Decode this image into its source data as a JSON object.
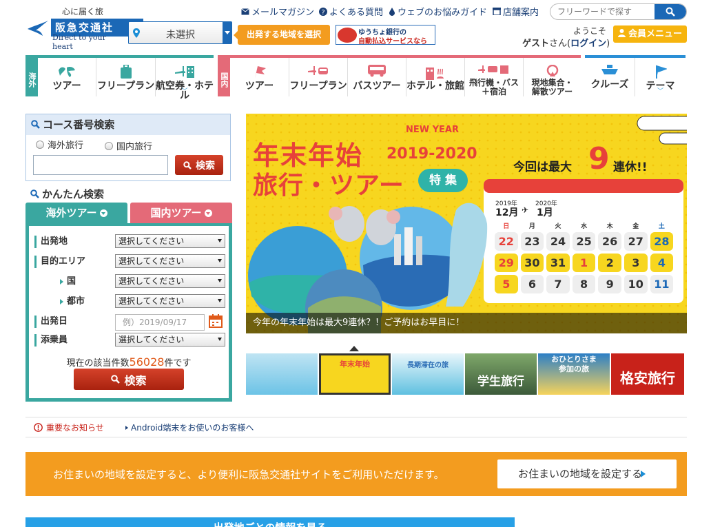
{
  "brand": {
    "tagline": "心に届く旅",
    "name": "阪急交通社",
    "subtitle": "Direct to your heart"
  },
  "region_select": {
    "value": "未選択"
  },
  "region_tip": "出発する地域を選択",
  "bank_banner": {
    "line1": "ゆうちょ銀行の",
    "line2": "自動払込サービスなら"
  },
  "top_links": [
    {
      "label": "メールマガジン",
      "icon": "mail-icon"
    },
    {
      "label": "よくある質問",
      "icon": "question-icon"
    },
    {
      "label": "ウェブのお悩みガイド",
      "icon": "drop-icon"
    },
    {
      "label": "店舗案内",
      "icon": "store-icon"
    }
  ],
  "search": {
    "placeholder": "フリーワードで探す"
  },
  "account": {
    "welcome": "ようこそ",
    "guest": "ゲスト",
    "san": "さん(",
    "login": "ログイン",
    "close": ")",
    "member_button": "会員メニュー"
  },
  "nav": {
    "overseas_label": "海外",
    "overseas": [
      "ツアー",
      "フリープラン",
      "航空券・ホテル"
    ],
    "domestic_label": "国内",
    "domestic": [
      "ツアー",
      "フリープラン",
      "バスツアー",
      "ホテル・旅館",
      "飛行機・バス\n＋宿泊",
      "現地集合・\n解散ツアー"
    ],
    "other": [
      "クルーズ",
      "テーマ"
    ]
  },
  "course_search": {
    "title": "コース番号検索",
    "radio_overseas": "海外旅行",
    "radio_domestic": "国内旅行",
    "input_value": "",
    "button": "検索"
  },
  "easy_search": {
    "title": "かんたん検索",
    "tab_overseas": "海外ツアー",
    "tab_domestic": "国内ツアー",
    "labels": {
      "departure": "出発地",
      "area": "目的エリア",
      "country": "国",
      "city": "都市",
      "date": "出発日",
      "guide": "添乗員"
    },
    "select_placeholder": "選択してください",
    "date_placeholder": "例）2019/09/17",
    "count_prefix": "現在の該当件数",
    "count": "56028",
    "count_suffix": "件です",
    "button": "検索"
  },
  "hero": {
    "new_year": "NEW YEAR",
    "title_line1": "年末年始",
    "years": "2019-2020",
    "title_line2": "旅行・ツアー",
    "feature": "特 集",
    "holiday_prefix": "今回は最大",
    "holiday_num": "9",
    "holiday_suffix": "連休!!",
    "cal_year1": "2019年",
    "cal_month1": "12月",
    "cal_year2": "2020年",
    "cal_month2": "1月",
    "weekdays": [
      "日",
      "月",
      "火",
      "水",
      "木",
      "金",
      "土"
    ],
    "weeks": [
      [
        "22",
        "23",
        "24",
        "25",
        "26",
        "27",
        "28"
      ],
      [
        "29",
        "30",
        "31",
        "1",
        "2",
        "3",
        "4"
      ],
      [
        "5",
        "6",
        "7",
        "8",
        "9",
        "10",
        "11"
      ]
    ],
    "caption": "今年の年末年始は最大9連休？！ご予約はお早目に！"
  },
  "thumbnails": [
    {
      "title": ""
    },
    {
      "title": "年末年始"
    },
    {
      "title": "長期滞在の旅"
    },
    {
      "title": "学生旅行"
    },
    {
      "title": "おひとりさま\n参加の旅"
    },
    {
      "title": "格安旅行"
    }
  ],
  "notices": {
    "important": "重要なお知らせ",
    "android": "Android端末をお使いのお客様へ"
  },
  "region_band": {
    "text": "お住まいの地域を設定すると、より便利に阪急交通社サイトをご利用いただけます。",
    "button": "お住まいの地域を設定する"
  },
  "departure_bar": "出発地ごとの情報を見る",
  "colors": {
    "brand_blue": "#1b68b6",
    "orange": "#f39c1f",
    "teal": "#3aa7a0",
    "pink": "#e46a78",
    "yellow": "#f5d21b"
  }
}
